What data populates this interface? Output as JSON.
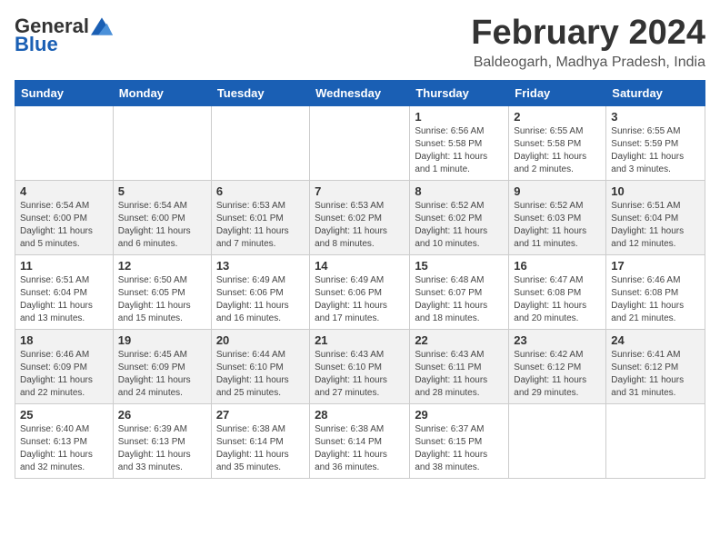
{
  "header": {
    "logo_general": "General",
    "logo_blue": "Blue",
    "month_title": "February 2024",
    "location": "Baldeogarh, Madhya Pradesh, India"
  },
  "days_of_week": [
    "Sunday",
    "Monday",
    "Tuesday",
    "Wednesday",
    "Thursday",
    "Friday",
    "Saturday"
  ],
  "weeks": [
    [
      {
        "day": "",
        "info": ""
      },
      {
        "day": "",
        "info": ""
      },
      {
        "day": "",
        "info": ""
      },
      {
        "day": "",
        "info": ""
      },
      {
        "day": "1",
        "info": "Sunrise: 6:56 AM\nSunset: 5:58 PM\nDaylight: 11 hours and 1 minute."
      },
      {
        "day": "2",
        "info": "Sunrise: 6:55 AM\nSunset: 5:58 PM\nDaylight: 11 hours and 2 minutes."
      },
      {
        "day": "3",
        "info": "Sunrise: 6:55 AM\nSunset: 5:59 PM\nDaylight: 11 hours and 3 minutes."
      }
    ],
    [
      {
        "day": "4",
        "info": "Sunrise: 6:54 AM\nSunset: 6:00 PM\nDaylight: 11 hours and 5 minutes."
      },
      {
        "day": "5",
        "info": "Sunrise: 6:54 AM\nSunset: 6:00 PM\nDaylight: 11 hours and 6 minutes."
      },
      {
        "day": "6",
        "info": "Sunrise: 6:53 AM\nSunset: 6:01 PM\nDaylight: 11 hours and 7 minutes."
      },
      {
        "day": "7",
        "info": "Sunrise: 6:53 AM\nSunset: 6:02 PM\nDaylight: 11 hours and 8 minutes."
      },
      {
        "day": "8",
        "info": "Sunrise: 6:52 AM\nSunset: 6:02 PM\nDaylight: 11 hours and 10 minutes."
      },
      {
        "day": "9",
        "info": "Sunrise: 6:52 AM\nSunset: 6:03 PM\nDaylight: 11 hours and 11 minutes."
      },
      {
        "day": "10",
        "info": "Sunrise: 6:51 AM\nSunset: 6:04 PM\nDaylight: 11 hours and 12 minutes."
      }
    ],
    [
      {
        "day": "11",
        "info": "Sunrise: 6:51 AM\nSunset: 6:04 PM\nDaylight: 11 hours and 13 minutes."
      },
      {
        "day": "12",
        "info": "Sunrise: 6:50 AM\nSunset: 6:05 PM\nDaylight: 11 hours and 15 minutes."
      },
      {
        "day": "13",
        "info": "Sunrise: 6:49 AM\nSunset: 6:06 PM\nDaylight: 11 hours and 16 minutes."
      },
      {
        "day": "14",
        "info": "Sunrise: 6:49 AM\nSunset: 6:06 PM\nDaylight: 11 hours and 17 minutes."
      },
      {
        "day": "15",
        "info": "Sunrise: 6:48 AM\nSunset: 6:07 PM\nDaylight: 11 hours and 18 minutes."
      },
      {
        "day": "16",
        "info": "Sunrise: 6:47 AM\nSunset: 6:08 PM\nDaylight: 11 hours and 20 minutes."
      },
      {
        "day": "17",
        "info": "Sunrise: 6:46 AM\nSunset: 6:08 PM\nDaylight: 11 hours and 21 minutes."
      }
    ],
    [
      {
        "day": "18",
        "info": "Sunrise: 6:46 AM\nSunset: 6:09 PM\nDaylight: 11 hours and 22 minutes."
      },
      {
        "day": "19",
        "info": "Sunrise: 6:45 AM\nSunset: 6:09 PM\nDaylight: 11 hours and 24 minutes."
      },
      {
        "day": "20",
        "info": "Sunrise: 6:44 AM\nSunset: 6:10 PM\nDaylight: 11 hours and 25 minutes."
      },
      {
        "day": "21",
        "info": "Sunrise: 6:43 AM\nSunset: 6:10 PM\nDaylight: 11 hours and 27 minutes."
      },
      {
        "day": "22",
        "info": "Sunrise: 6:43 AM\nSunset: 6:11 PM\nDaylight: 11 hours and 28 minutes."
      },
      {
        "day": "23",
        "info": "Sunrise: 6:42 AM\nSunset: 6:12 PM\nDaylight: 11 hours and 29 minutes."
      },
      {
        "day": "24",
        "info": "Sunrise: 6:41 AM\nSunset: 6:12 PM\nDaylight: 11 hours and 31 minutes."
      }
    ],
    [
      {
        "day": "25",
        "info": "Sunrise: 6:40 AM\nSunset: 6:13 PM\nDaylight: 11 hours and 32 minutes."
      },
      {
        "day": "26",
        "info": "Sunrise: 6:39 AM\nSunset: 6:13 PM\nDaylight: 11 hours and 33 minutes."
      },
      {
        "day": "27",
        "info": "Sunrise: 6:38 AM\nSunset: 6:14 PM\nDaylight: 11 hours and 35 minutes."
      },
      {
        "day": "28",
        "info": "Sunrise: 6:38 AM\nSunset: 6:14 PM\nDaylight: 11 hours and 36 minutes."
      },
      {
        "day": "29",
        "info": "Sunrise: 6:37 AM\nSunset: 6:15 PM\nDaylight: 11 hours and 38 minutes."
      },
      {
        "day": "",
        "info": ""
      },
      {
        "day": "",
        "info": ""
      }
    ]
  ]
}
